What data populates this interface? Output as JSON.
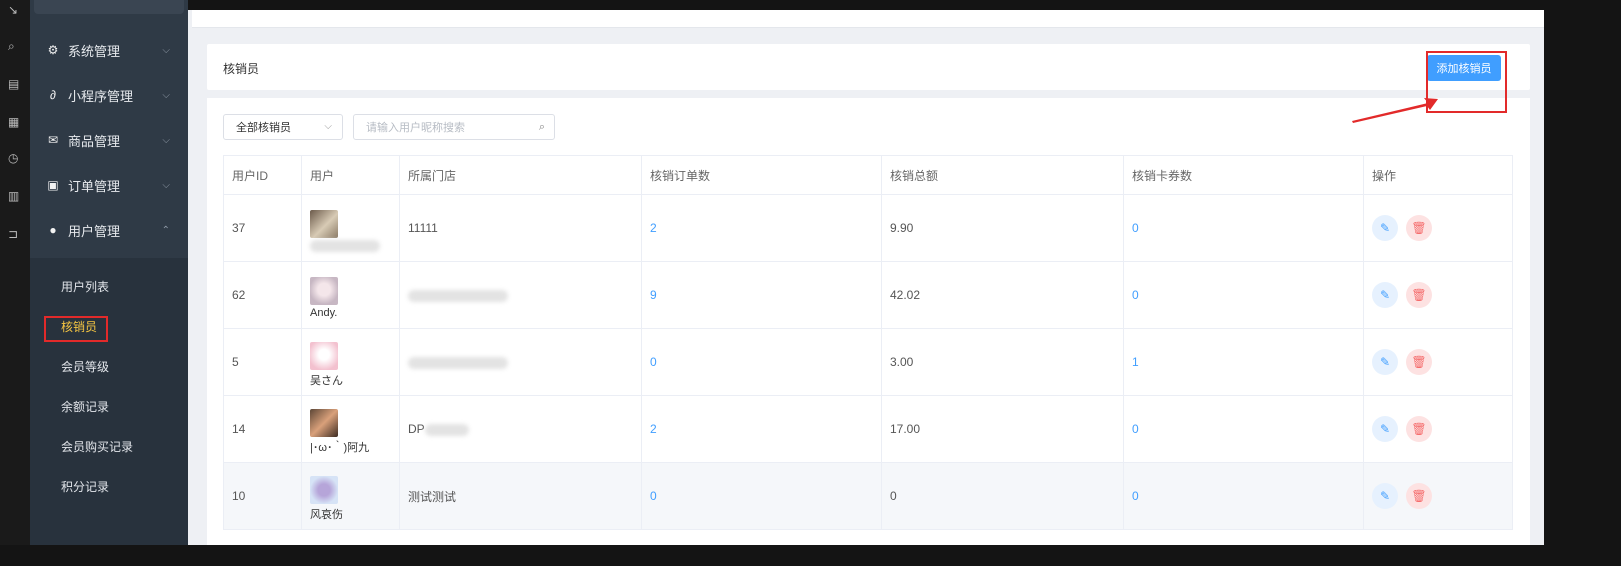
{
  "sidebar": {
    "menu": [
      {
        "label": "系统管理",
        "icon": "gear-icon"
      },
      {
        "label": "小程序管理",
        "icon": "link-icon"
      },
      {
        "label": "商品管理",
        "icon": "mail-icon"
      },
      {
        "label": "订单管理",
        "icon": "clipboard-icon"
      },
      {
        "label": "用户管理",
        "icon": "user-icon"
      }
    ],
    "submenu": [
      {
        "label": "用户列表"
      },
      {
        "label": "核销员"
      },
      {
        "label": "会员等级"
      },
      {
        "label": "余额记录"
      },
      {
        "label": "会员购买记录"
      },
      {
        "label": "积分记录"
      }
    ]
  },
  "header": {
    "title": "核销员",
    "add_button": "添加核销员"
  },
  "filter": {
    "select_value": "全部核销员",
    "search_placeholder": "请输入用户昵称搜索"
  },
  "table": {
    "columns": [
      "用户ID",
      "用户",
      "所属门店",
      "核销订单数",
      "核销总额",
      "核销卡券数",
      "操作"
    ],
    "rows": [
      {
        "id": "37",
        "name": "",
        "store": "11111",
        "orders": "2",
        "total": "9.90",
        "cards": "0"
      },
      {
        "id": "62",
        "name": "Andy.",
        "store": "",
        "orders": "9",
        "total": "42.02",
        "cards": "0"
      },
      {
        "id": "5",
        "name": "吴さん",
        "store": "",
        "orders": "0",
        "total": "3.00",
        "cards": "1"
      },
      {
        "id": "14",
        "name": "|･ω･｀)阿九",
        "store": "DP",
        "orders": "2",
        "total": "17.00",
        "cards": "0"
      },
      {
        "id": "10",
        "name": "风哀伤",
        "store": "测试测试",
        "orders": "0",
        "total": "0",
        "cards": "0"
      }
    ]
  },
  "colors": {
    "sidebar_bg": "#2f3a46",
    "accent": "#409eff",
    "danger": "#f56c6c",
    "active_menu": "#f5c542",
    "annotation": "#e22a2a"
  }
}
